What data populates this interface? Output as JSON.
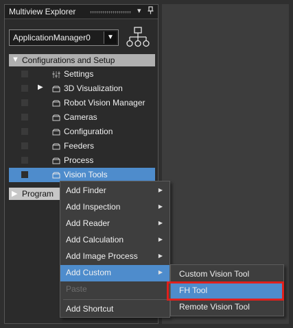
{
  "explorer": {
    "title": "Multiview Explorer",
    "pin_glyph": "▾",
    "pushpin_glyph": "ꟸ",
    "app_selector": {
      "value": "ApplicationManager0",
      "arrow": "▼"
    }
  },
  "tree": {
    "category_config": {
      "label": "Configurations and Setup",
      "toggle": "▼"
    },
    "items": [
      {
        "label": "Settings",
        "expander": ""
      },
      {
        "label": "3D Visualization",
        "expander": "▶"
      },
      {
        "label": "Robot Vision Manager",
        "expander": ""
      },
      {
        "label": "Cameras",
        "expander": ""
      },
      {
        "label": "Configuration",
        "expander": ""
      },
      {
        "label": "Feeders",
        "expander": ""
      },
      {
        "label": "Process",
        "expander": ""
      },
      {
        "label": "Vision Tools",
        "expander": ""
      }
    ],
    "category_programming": {
      "label": "Program",
      "toggle": "▶"
    }
  },
  "context_menu": {
    "items": [
      {
        "label": "Add Finder",
        "arrow": "▶"
      },
      {
        "label": "Add Inspection",
        "arrow": "▶"
      },
      {
        "label": "Add Reader",
        "arrow": "▶"
      },
      {
        "label": "Add Calculation",
        "arrow": "▶"
      },
      {
        "label": "Add Image Process",
        "arrow": "▶"
      },
      {
        "label": "Add Custom",
        "arrow": "▶"
      },
      {
        "label": "Paste",
        "arrow": ""
      },
      {
        "label": "Add Shortcut",
        "arrow": ""
      }
    ]
  },
  "submenu": {
    "items": [
      {
        "label": "Custom Vision Tool"
      },
      {
        "label": "FH Tool"
      },
      {
        "label": "Remote Vision Tool"
      }
    ]
  },
  "colors": {
    "selection": "#4e8ccc",
    "highlight_box": "#e0201c",
    "panel_bg": "#2b2b2b"
  }
}
